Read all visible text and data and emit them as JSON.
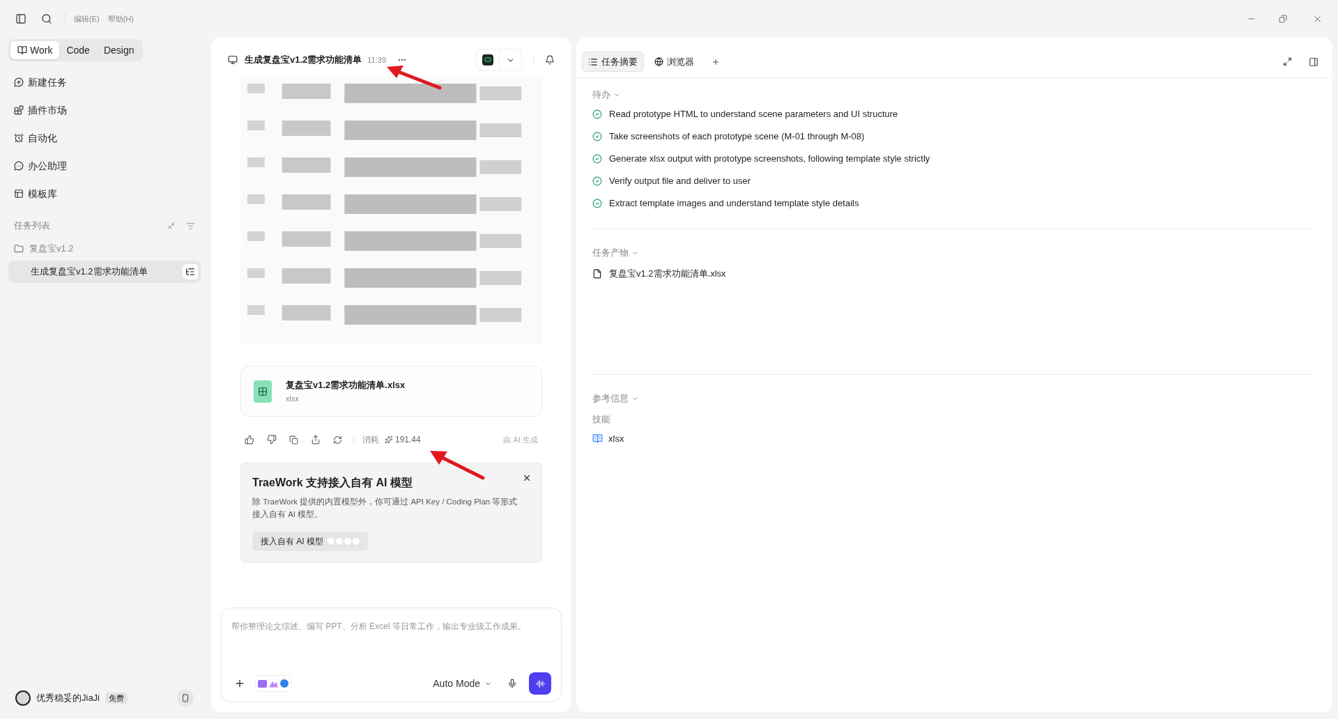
{
  "menu": [
    "编辑(E)",
    "帮助(H)"
  ],
  "modes": [
    {
      "label": "Work",
      "selected": true
    },
    {
      "label": "Code",
      "selected": false
    },
    {
      "label": "Design",
      "selected": false
    }
  ],
  "nav": [
    "新建任务",
    "插件市场",
    "自动化",
    "办公助理",
    "模板库"
  ],
  "task_list": {
    "title": "任务列表",
    "folder": "复盘宝v1.2",
    "tasks": [
      {
        "label": "生成复盘宝v1.2需求功能清单",
        "selected": true
      }
    ]
  },
  "user": {
    "name": "优秀稳妥的JiaJi",
    "badge": "免费"
  },
  "chat": {
    "title": "生成复盘宝v1.2需求功能清单",
    "time": "11:39",
    "file": {
      "name": "复盘宝v1.2需求功能清单.xlsx",
      "type": "xlsx"
    },
    "cost_label": "消耗",
    "cost": "191.44",
    "ai_note": "由 AI 生成",
    "promo": {
      "title": "TraeWork 支持接入自有 AI 模型",
      "body": "除 TraeWork 提供的内置模型外，你可通过 API Key / Coding Plan 等形式接入自有 AI 模型。",
      "button": "接入自有 AI 模型"
    },
    "input": {
      "placeholder": "帮你整理论文综述、编写 PPT、分析 Excel 等日常工作，输出专业级工作成果。",
      "mode": "Auto Mode"
    }
  },
  "panel": {
    "tabs": [
      {
        "label": "任务摘要",
        "selected": true
      },
      {
        "label": "浏览器",
        "selected": false
      }
    ],
    "todo": {
      "title": "待办",
      "items": [
        {
          "text": "Read prototype HTML to understand scene parameters and UI structure",
          "done": true
        },
        {
          "text": "Take screenshots of each prototype scene (M-01 through M-08)",
          "done": true
        },
        {
          "text": "Generate xlsx output with prototype screenshots, following template style strictly",
          "done": true
        },
        {
          "text": "Verify output file and deliver to user",
          "done": true
        },
        {
          "text": "Extract template images and understand template style details",
          "done": true
        }
      ]
    },
    "outputs": {
      "title": "任务产物",
      "files": [
        "复盘宝v1.2需求功能清单.xlsx"
      ]
    },
    "refs": {
      "title": "参考信息",
      "label": "技能",
      "skills": [
        "xlsx"
      ]
    }
  }
}
